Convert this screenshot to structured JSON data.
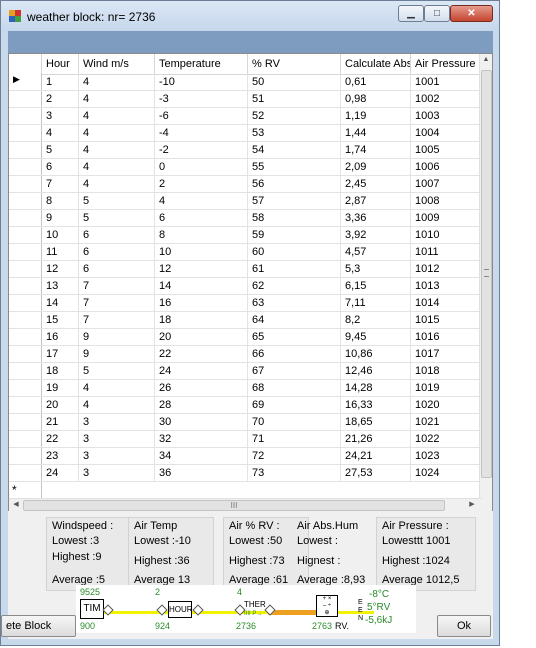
{
  "window": {
    "title": "weather  block:  nr= 2736"
  },
  "grid": {
    "headers": [
      "Hour",
      "Wind m/s",
      "Temperature",
      "% RV",
      "Calculate Abs",
      "Air Pressure"
    ],
    "rows": [
      [
        "1",
        "4",
        "-10",
        "50",
        "0,61",
        "1001"
      ],
      [
        "2",
        "4",
        "-3",
        "51",
        "0,98",
        "1002"
      ],
      [
        "3",
        "4",
        "-6",
        "52",
        "1,19",
        "1003"
      ],
      [
        "4",
        "4",
        "-4",
        "53",
        "1,44",
        "1004"
      ],
      [
        "5",
        "4",
        "-2",
        "54",
        "1,74",
        "1005"
      ],
      [
        "6",
        "4",
        "0",
        "55",
        "2,09",
        "1006"
      ],
      [
        "7",
        "4",
        "2",
        "56",
        "2,45",
        "1007"
      ],
      [
        "8",
        "5",
        "4",
        "57",
        "2,87",
        "1008"
      ],
      [
        "9",
        "5",
        "6",
        "58",
        "3,36",
        "1009"
      ],
      [
        "10",
        "6",
        "8",
        "59",
        "3,92",
        "1010"
      ],
      [
        "11",
        "6",
        "10",
        "60",
        "4,57",
        "1011"
      ],
      [
        "12",
        "6",
        "12",
        "61",
        "5,3",
        "1012"
      ],
      [
        "13",
        "7",
        "14",
        "62",
        "6,15",
        "1013"
      ],
      [
        "14",
        "7",
        "16",
        "63",
        "7,11",
        "1014"
      ],
      [
        "15",
        "7",
        "18",
        "64",
        "8,2",
        "1015"
      ],
      [
        "16",
        "9",
        "20",
        "65",
        "9,45",
        "1016"
      ],
      [
        "17",
        "9",
        "22",
        "66",
        "10,86",
        "1017"
      ],
      [
        "18",
        "5",
        "24",
        "67",
        "12,46",
        "1018"
      ],
      [
        "19",
        "4",
        "26",
        "68",
        "14,28",
        "1019"
      ],
      [
        "20",
        "4",
        "28",
        "69",
        "16,33",
        "1020"
      ],
      [
        "21",
        "3",
        "30",
        "70",
        "18,65",
        "1021"
      ],
      [
        "22",
        "3",
        "32",
        "71",
        "21,26",
        "1022"
      ],
      [
        "23",
        "3",
        "34",
        "72",
        "24,21",
        "1023"
      ],
      [
        "24",
        "3",
        "36",
        "73",
        "27,53",
        "1024"
      ]
    ],
    "new_row_marker": "*",
    "current_row_marker": "▶",
    "hscroll_thumb": "III"
  },
  "stats": {
    "wind": {
      "title": "Windspeed :",
      "lowest": "Lowest :3",
      "highest": "Highest :9",
      "average": "Average :5"
    },
    "temp": {
      "title": "Air Temp",
      "lowest": "Lowest :-10",
      "highest": "Highest :36",
      "average": "Average  13"
    },
    "rv": {
      "title": "Air % RV :",
      "lowest": "Lowest :50",
      "highest": "Highest :73",
      "average": "Average :61"
    },
    "abs": {
      "title": "Air Abs.Hum",
      "lowest": "Lowest :",
      "highest": "Hignest :",
      "average": "Average :8,93"
    },
    "pressure": {
      "title": "Air Pressure  :",
      "lowest": "Lowesttt  1001",
      "highest": "Highest :1024",
      "average": "Average  1012,5"
    }
  },
  "diagram": {
    "n1_top": "9525",
    "n1_label": "TIM",
    "n1_bottom": "900",
    "n2_top": "2",
    "n2_label": "HOUR",
    "n2_bottom": "924",
    "n3_top": "4",
    "n3_label": "THER",
    "n3_sub": "IIII P→",
    "n3_bottom": "2736",
    "n4_bottom": "2763",
    "n4_label": "RV.",
    "side_letters": "E E N",
    "out_temp": "-8°C",
    "out_rv": "5°RV",
    "out_energy": "-5,6kJ"
  },
  "buttons": {
    "delete": "ete Block",
    "ok": "Ok"
  },
  "colors": {
    "accent_bar": "#7d9cc0",
    "diagram_green": "#2a8a2a",
    "wire_yellow": "#f2f200",
    "wire_orange": "#f0a020"
  }
}
